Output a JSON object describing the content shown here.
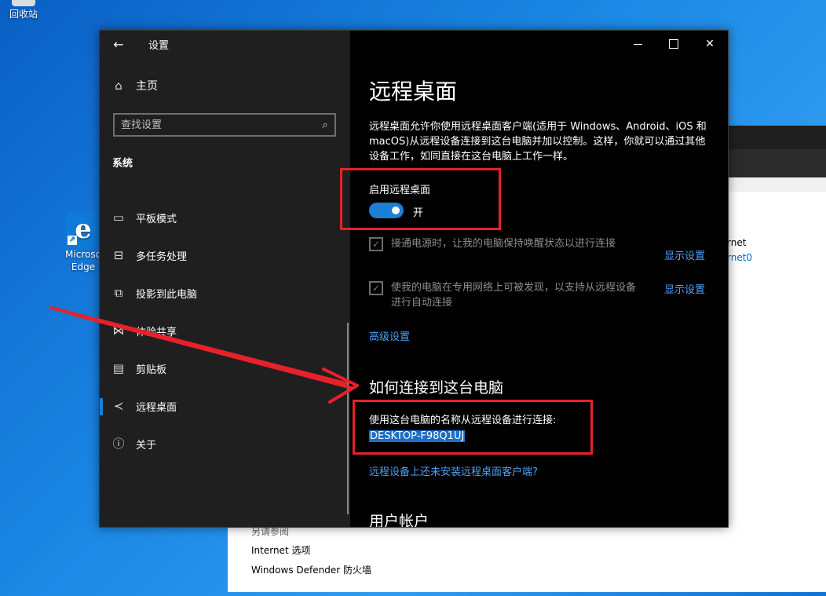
{
  "desktop": {
    "recycle_label": "回收站",
    "edge_label_1": "Microso",
    "edge_label_2": "Edge"
  },
  "background_window": {
    "side_text_1": "rnet",
    "side_text_2": "rnet0",
    "see_also": "另请参阅",
    "internet_options": "Internet 选项",
    "firewall": "Windows Defender 防火墙"
  },
  "window": {
    "app_title": "设置",
    "home_label": "主页",
    "search_placeholder": "查找设置",
    "section_title": "系统",
    "nav_items": [
      {
        "label": "平板模式",
        "icon": "tablet-mode-icon"
      },
      {
        "label": "多任务处理",
        "icon": "multitasking-icon"
      },
      {
        "label": "投影到此电脑",
        "icon": "project-icon"
      },
      {
        "label": "体验共享",
        "icon": "shared-experiences-icon"
      },
      {
        "label": "剪贴板",
        "icon": "clipboard-icon"
      },
      {
        "label": "远程桌面",
        "icon": "remote-desktop-icon",
        "selected": true
      },
      {
        "label": "关于",
        "icon": "info-icon"
      }
    ]
  },
  "content": {
    "page_title": "远程桌面",
    "description": "远程桌面允许你使用远程桌面客户端(适用于 Windows、Android、iOS 和 macOS)从远程设备连接到这台电脑并加以控制。这样，你就可以通过其他设备工作，如同直接在这台电脑上工作一样。",
    "toggle_label": "启用远程桌面",
    "toggle_state": "开",
    "checkbox_1": "接通电源时，让我的电脑保持唤醒状态以进行连接",
    "checkbox_2_line1": "使我的电脑在专用网络上可被发现，以支持从远程设备",
    "checkbox_2_line2": "进行自动连接",
    "show_settings_1": "显示设置",
    "show_settings_2": "显示设置",
    "advanced_settings": "高级设置",
    "how_to_connect": "如何连接到这台电脑",
    "connect_label": "使用这台电脑的名称从远程设备进行连接:",
    "pc_name": "DESKTOP-F98Q1UJ",
    "client_link": "远程设备上还未安装远程桌面客户端?",
    "user_accounts": "用户帐户"
  },
  "colors": {
    "accent": "#1a7fd6",
    "link": "#4ca2f5",
    "annotation": "#e8202a"
  }
}
